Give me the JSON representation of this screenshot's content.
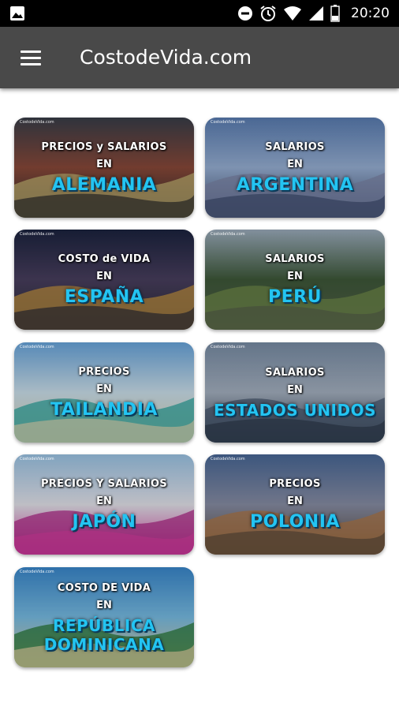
{
  "status_bar": {
    "time": "20:20",
    "icons": [
      "image-icon",
      "do-not-disturb-icon",
      "alarm-icon",
      "wifi-icon",
      "signal-icon",
      "battery-icon"
    ]
  },
  "app_bar": {
    "title": "CostodeVida.com",
    "menu_icon": "hamburger-menu-icon"
  },
  "cards": [
    {
      "id": "alemania",
      "brand": "CostodeVida.com",
      "topic": "PRECIOS y SALARIOS",
      "connector": "EN",
      "country": "ALEMANIA",
      "colors": [
        "#3a3f4a",
        "#8b4a3a",
        "#c0b070",
        "#2b2b2b"
      ]
    },
    {
      "id": "argentina",
      "brand": "CostodeVida.com",
      "topic": "SALARIOS",
      "connector": "EN",
      "country": "ARGENTINA",
      "colors": [
        "#5b7fb5",
        "#9ab3d8",
        "#7c86a8",
        "#3d4c6e"
      ]
    },
    {
      "id": "espana",
      "brand": "CostodeVida.com",
      "topic": "COSTO de VIDA",
      "connector": "EN",
      "country": "ESPAÑA",
      "colors": [
        "#1c2440",
        "#4a4060",
        "#c09040",
        "#2a2a35"
      ]
    },
    {
      "id": "peru",
      "brand": "CostodeVida.com",
      "topic": "SALARIOS",
      "connector": "EN",
      "country": "PERÚ",
      "colors": [
        "#9fb0c0",
        "#3f5a3a",
        "#6f8a4a",
        "#55604a"
      ]
    },
    {
      "id": "tailandia",
      "brand": "CostodeVida.com",
      "topic": "PRECIOS",
      "connector": "EN",
      "country": "TAILANDIA",
      "colors": [
        "#6aa8e0",
        "#cfe4f0",
        "#2fa7a0",
        "#d8d4b0"
      ]
    },
    {
      "id": "estados-unidos",
      "brand": "CostodeVida.com",
      "topic": "SALARIOS",
      "connector": "EN",
      "country": "ESTADOS UNIDOS",
      "colors": [
        "#7a8fa8",
        "#a8b4c4",
        "#4a5a70",
        "#2d3a4c"
      ]
    },
    {
      "id": "japon",
      "brand": "CostodeVida.com",
      "topic": "PRECIOS Y SALARIOS",
      "connector": "EN",
      "country": "JAPÓN",
      "colors": [
        "#9ec8ea",
        "#e8e8f0",
        "#b02a8a",
        "#d43ca0"
      ]
    },
    {
      "id": "polonia",
      "brand": "CostodeVida.com",
      "topic": "PRECIOS",
      "connector": "EN",
      "country": "POLONIA",
      "colors": [
        "#4a6a9a",
        "#8a90a8",
        "#b07848",
        "#5a4a3a"
      ]
    },
    {
      "id": "republica-dominicana",
      "brand": "CostodeVida.com",
      "topic": "COSTO DE VIDA",
      "connector": "EN",
      "country": "REPÚBLICA DOMINICANA",
      "country_lines": [
        "REPÚBLICA",
        "DOMINICANA"
      ],
      "colors": [
        "#3a8ad0",
        "#7ac0e8",
        "#2a7a3a",
        "#e0d0a0"
      ]
    }
  ],
  "theme": {
    "app_bar_bg": "#494949",
    "status_bar_bg": "#000000",
    "country_text": "#23c4f2"
  }
}
